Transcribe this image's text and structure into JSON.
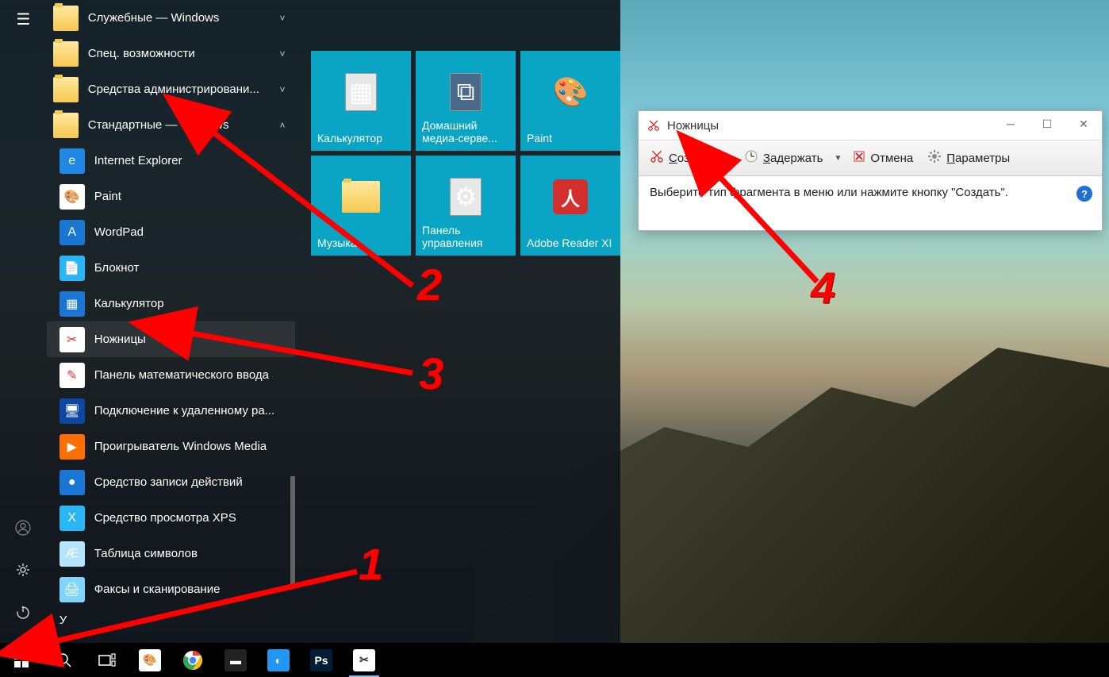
{
  "start_menu": {
    "folders": [
      {
        "label": "Служебные — Windows",
        "expanded": false,
        "chev": "˅"
      },
      {
        "label": "Спец. возможности",
        "expanded": false,
        "chev": "˅"
      },
      {
        "label": "Средства администрировани...",
        "expanded": false,
        "chev": "˅"
      },
      {
        "label": "Стандартные — Windows",
        "expanded": true,
        "chev": "˄"
      }
    ],
    "apps": [
      {
        "label": "Internet Explorer",
        "ic": "e",
        "bg": "#1e88e5"
      },
      {
        "label": "Paint",
        "ic": "🎨",
        "bg": "#ffffff"
      },
      {
        "label": "WordPad",
        "ic": "A",
        "bg": "#1976d2"
      },
      {
        "label": "Блокнот",
        "ic": "📄",
        "bg": "#29b6f6"
      },
      {
        "label": "Калькулятор",
        "ic": "▦",
        "bg": "#1976d2"
      },
      {
        "label": "Ножницы",
        "ic": "✂",
        "bg": "#ffffff",
        "hilite": true
      },
      {
        "label": "Панель математического ввода",
        "ic": "✎",
        "bg": "#ffffff"
      },
      {
        "label": "Подключение к удаленному ра...",
        "ic": "🖥",
        "bg": "#0d47a1"
      },
      {
        "label": "Проигрыватель Windows Media",
        "ic": "▶",
        "bg": "#ff6f00"
      },
      {
        "label": "Средство записи действий",
        "ic": "●",
        "bg": "#1976d2"
      },
      {
        "label": "Средство просмотра XPS",
        "ic": "X",
        "bg": "#29b6f6"
      },
      {
        "label": "Таблица символов",
        "ic": "Æ",
        "bg": "#b3e5fc"
      },
      {
        "label": "Факсы и сканирование",
        "ic": "🖨",
        "bg": "#81d4fa"
      }
    ],
    "letter": "У"
  },
  "tiles": [
    {
      "label": "Калькулятор",
      "icon": "calc"
    },
    {
      "label": "Домашний медиа-серве...",
      "icon": "media"
    },
    {
      "label": "Paint",
      "icon": "paint"
    },
    {
      "label": "Музыка",
      "icon": "folder"
    },
    {
      "label": "Панель управления",
      "icon": "control"
    },
    {
      "label": "Adobe Reader XI",
      "icon": "adobe"
    }
  ],
  "snip": {
    "title": "Ножницы",
    "create": "Создать",
    "delay": "Задержать",
    "cancel": "Отмена",
    "params": "Параметры",
    "body": "Выберите тип фрагмента в меню или нажмите кнопку \"Создать\"."
  },
  "annotations": {
    "n1": "1",
    "n2": "2",
    "n3": "3",
    "n4": "4"
  },
  "taskbar": {
    "apps": [
      {
        "name": "paint",
        "bg": "#fff",
        "txt": "🎨"
      },
      {
        "name": "chrome",
        "bg": "#fff",
        "txt": "◉"
      },
      {
        "name": "cmd",
        "bg": "#222",
        "txt": "▬"
      },
      {
        "name": "blue",
        "bg": "#2196f3",
        "txt": "◐"
      },
      {
        "name": "ps",
        "bg": "#001e36",
        "txt": "Ps"
      },
      {
        "name": "snip",
        "bg": "#fff",
        "txt": "✂",
        "active": true
      }
    ]
  }
}
